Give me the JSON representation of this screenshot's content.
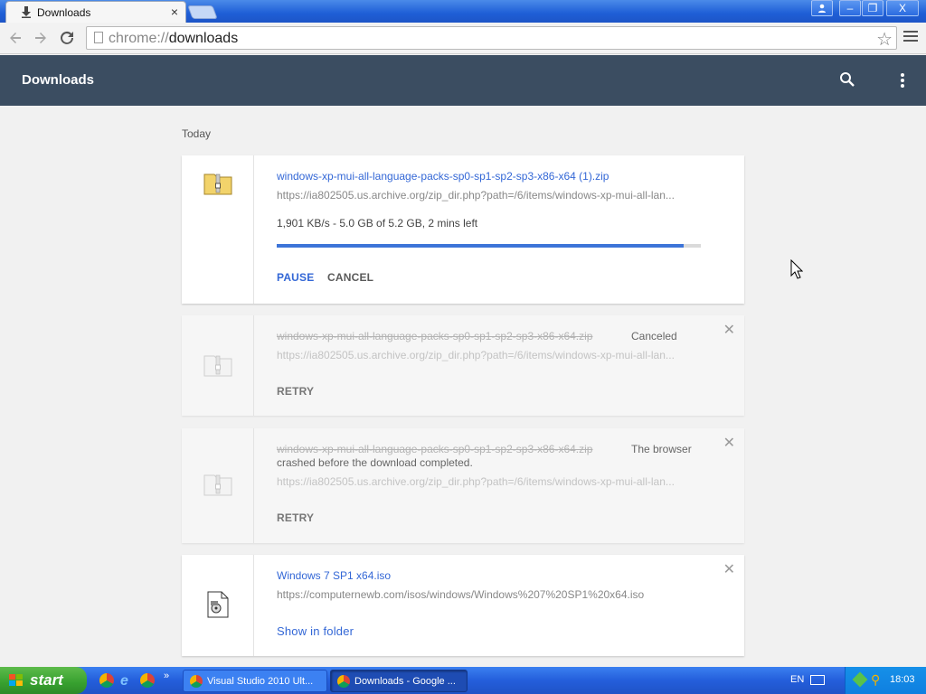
{
  "window": {
    "tab_title": "Downloads",
    "tab_close": "×",
    "controls": {
      "minimize": "–",
      "maximize": "❐",
      "close": "X"
    }
  },
  "toolbar": {
    "url_scheme": "chrome://",
    "url_path": "downloads"
  },
  "header": {
    "title": "Downloads"
  },
  "section": {
    "label": "Today"
  },
  "downloads": [
    {
      "file_name": "windows-xp-mui-all-language-packs-sp0-sp1-sp2-sp3-x86-x64 (1).zip",
      "url": "https://ia802505.us.archive.org/zip_dir.php?path=/6/items/windows-xp-mui-all-lan...",
      "speed": "1,901 KB/s - 5.0 GB of 5.2 GB, 2 mins left",
      "progress": 0.96,
      "pause_label": "PAUSE",
      "cancel_label": "CANCEL"
    },
    {
      "file_name": "windows-xp-mui-all-language-packs-sp0-sp1-sp2-sp3-x86-x64.zip",
      "status": "Canceled",
      "url": "https://ia802505.us.archive.org/zip_dir.php?path=/6/items/windows-xp-mui-all-lan...",
      "retry_label": "RETRY"
    },
    {
      "file_name": "windows-xp-mui-all-language-packs-sp0-sp1-sp2-sp3-x86-x64.zip",
      "status": "The browser",
      "status_cont": "crashed before the download completed.",
      "url": "https://ia802505.us.archive.org/zip_dir.php?path=/6/items/windows-xp-mui-all-lan...",
      "retry_label": "RETRY"
    },
    {
      "file_name": "Windows 7 SP1 x64.iso",
      "url": "https://computernewb.com/isos/windows/Windows%207%20SP1%20x64.iso",
      "show_label": "Show in folder"
    }
  ],
  "taskbar": {
    "start_label": "start",
    "tasks": [
      "Visual Studio 2010 Ult...",
      "Downloads - Google ..."
    ],
    "language": "EN",
    "clock": "18:03",
    "more": "»"
  }
}
